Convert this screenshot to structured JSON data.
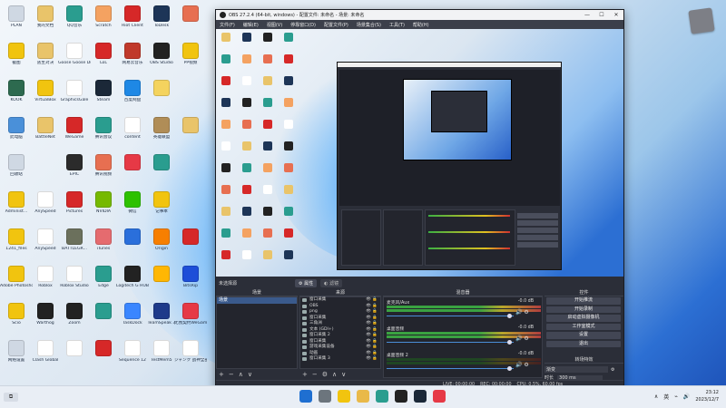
{
  "desktop": {
    "icons": [
      {
        "label": "PLAN",
        "color": "#cfd8e3",
        "col": 0,
        "row": 0
      },
      {
        "label": "我的文档",
        "color": "#e9c46a",
        "col": 1,
        "row": 0
      },
      {
        "label": "QQ音乐",
        "color": "#2a9d8f",
        "col": 2,
        "row": 0
      },
      {
        "label": "Scratch",
        "color": "#f4a261",
        "col": 3,
        "row": 0
      },
      {
        "label": "Riot Client",
        "color": "#d62828",
        "col": 4,
        "row": 0
      },
      {
        "label": "ToDesk",
        "color": "#1d3557",
        "col": 5,
        "row": 0
      },
      {
        "label": "",
        "color": "#e76f51",
        "col": 6,
        "row": 0
      },
      {
        "label": "截图",
        "color": "#f1c40f",
        "col": 0,
        "row": 1
      },
      {
        "label": "逃生对决",
        "color": "#e9c46a",
        "col": 1,
        "row": 1
      },
      {
        "label": "Goose Goose Duck",
        "color": "#ffffff",
        "col": 2,
        "row": 1
      },
      {
        "label": "LoL",
        "color": "#d62828",
        "col": 3,
        "row": 1
      },
      {
        "label": "网易云音乐",
        "color": "#c0392b",
        "col": 4,
        "row": 1
      },
      {
        "label": "OBS Studio",
        "color": "#222222",
        "col": 5,
        "row": 1
      },
      {
        "label": "PP视频",
        "color": "#f1c40f",
        "col": 6,
        "row": 1
      },
      {
        "label": "KOOK",
        "color": "#2d6a4f",
        "col": 0,
        "row": 2
      },
      {
        "label": "VirtualBox",
        "color": "#f1c40f",
        "col": 1,
        "row": 2
      },
      {
        "label": "GraphicsGale",
        "color": "#ffffff",
        "col": 2,
        "row": 2
      },
      {
        "label": "Steam",
        "color": "#1b2838",
        "col": 3,
        "row": 2
      },
      {
        "label": "百度网盘",
        "color": "#1e88e5",
        "col": 4,
        "row": 2
      },
      {
        "label": "",
        "color": "#f4d35e",
        "col": 5,
        "row": 2
      },
      {
        "label": "此电脑",
        "color": "#4a90d9",
        "col": 0,
        "row": 3
      },
      {
        "label": "BattleNet",
        "color": "#e9c46a",
        "col": 1,
        "row": 3
      },
      {
        "label": "WeGame",
        "color": "#d62828",
        "col": 2,
        "row": 3
      },
      {
        "label": "腾讯会议",
        "color": "#2a9d8f",
        "col": 3,
        "row": 3
      },
      {
        "label": "content",
        "color": "#ffffff",
        "col": 4,
        "row": 3
      },
      {
        "label": "英雄联盟",
        "color": "#b08d57",
        "col": 5,
        "row": 3
      },
      {
        "label": "",
        "color": "#e9c46a",
        "col": 6,
        "row": 3
      },
      {
        "label": "回收站",
        "color": "#cfd8e3",
        "col": 0,
        "row": 4
      },
      {
        "label": "EPIC",
        "color": "#2b2b2b",
        "col": 2,
        "row": 4
      },
      {
        "label": "腾讯视频",
        "color": "#e76f51",
        "col": 3,
        "row": 4
      },
      {
        "label": "",
        "color": "#e63946",
        "col": 4,
        "row": 4
      },
      {
        "label": "",
        "color": "#2a9d8f",
        "col": 5,
        "row": 4
      },
      {
        "label": "Administ...",
        "color": "#f1c40f",
        "col": 0,
        "row": 5
      },
      {
        "label": "AnySpeed",
        "color": "#ffffff",
        "col": 1,
        "row": 5
      },
      {
        "label": "Pictures",
        "color": "#d62828",
        "col": 2,
        "row": 5
      },
      {
        "label": "NVIDIA",
        "color": "#76b900",
        "col": 3,
        "row": 5
      },
      {
        "label": "微信",
        "color": "#2dc100",
        "col": 4,
        "row": 5
      },
      {
        "label": "记事本",
        "color": "#f1c40f",
        "col": 5,
        "row": 5
      },
      {
        "label": "1241_files",
        "color": "#f1c40f",
        "col": 0,
        "row": 6
      },
      {
        "label": "AnySpeed",
        "color": "#ffffff",
        "col": 1,
        "row": 6
      },
      {
        "label": "BATTLEGR...",
        "color": "#6b705c",
        "col": 2,
        "row": 6
      },
      {
        "label": "iTunes",
        "color": "#e56b6f",
        "col": 3,
        "row": 6
      },
      {
        "label": "",
        "color": "#2a6fdb",
        "col": 4,
        "row": 6
      },
      {
        "label": "Origin",
        "color": "#f77f00",
        "col": 5,
        "row": 6
      },
      {
        "label": "",
        "color": "#d62828",
        "col": 6,
        "row": 6
      },
      {
        "label": "Adobe Photoshop",
        "color": "#f1c40f",
        "col": 0,
        "row": 7
      },
      {
        "label": "Roblox",
        "color": "#ffffff",
        "col": 1,
        "row": 7
      },
      {
        "label": "Roblox Studio",
        "color": "#ffffff",
        "col": 2,
        "row": 7
      },
      {
        "label": "Edge",
        "color": "#2a9d8f",
        "col": 3,
        "row": 7
      },
      {
        "label": "Logitech G HUB",
        "color": "#222222",
        "col": 4,
        "row": 7
      },
      {
        "label": "",
        "color": "#ffb703",
        "col": 5,
        "row": 7
      },
      {
        "label": "BitsRip",
        "color": "#1d4ed8",
        "col": 6,
        "row": 7
      },
      {
        "label": "Scio",
        "color": "#f1c40f",
        "col": 0,
        "row": 8
      },
      {
        "label": "Warthog",
        "color": "#222222",
        "col": 1,
        "row": 8
      },
      {
        "label": "Zoom",
        "color": "#222222",
        "col": 2,
        "row": 8
      },
      {
        "label": "",
        "color": "#2a9d8f",
        "col": 3,
        "row": 8
      },
      {
        "label": "TaskDock",
        "color": "#3a86ff",
        "col": 4,
        "row": 8
      },
      {
        "label": "TeamSpeak 3",
        "color": "#1e3a8a",
        "col": 5,
        "row": 8
      },
      {
        "label": "无畏契约WeGame版",
        "color": "#e63946",
        "col": 6,
        "row": 8
      },
      {
        "label": "网络设置",
        "color": "#cfd8e3",
        "col": 0,
        "row": 9
      },
      {
        "label": "Clash Global",
        "color": "#ffffff",
        "col": 1,
        "row": 9
      },
      {
        "label": "",
        "color": "#ffffff",
        "col": 2,
        "row": 9
      },
      {
        "label": "",
        "color": "#d62828",
        "col": 3,
        "row": 9
      },
      {
        "label": "Sequence 12",
        "color": "#ffffff",
        "col": 4,
        "row": 9
      },
      {
        "label": "TestMem5",
        "color": "#ffffff",
        "col": 5,
        "row": 9
      },
      {
        "label": "ジャンク 战神全部",
        "color": "#ffffff",
        "col": 6,
        "row": 9
      }
    ]
  },
  "obs": {
    "title": "OBS 27.2.4 (64-bit, windows) - 配置文件: 未命名 - 场景: 未命名",
    "menu": [
      "文件(F)",
      "编辑(E)",
      "视图(V)",
      "停靠窗口(D)",
      "配置文件(P)",
      "场景集合(S)",
      "工具(T)",
      "帮助(H)"
    ],
    "scene_label": "未选择源",
    "props_btn": "属性",
    "filters_btn": "滤镜",
    "panels": {
      "scenes": "场景",
      "sources": "来源",
      "mixer": "混音器",
      "transitions": "转场特效",
      "controls": "控件"
    },
    "scenes_list": [
      "场景"
    ],
    "sources_list": [
      "窗口采集",
      "OBS",
      "png",
      "窗口采集",
      "三角洲",
      "文本 (GDI+)",
      "窗口采集 2",
      "窗口采集",
      "游戏采集设备",
      "动画",
      "窗口采集 3"
    ],
    "mixer": [
      {
        "name": "麦克风/Aux",
        "db": "-0.0 dB",
        "active": true
      },
      {
        "name": "桌面音频",
        "db": "-0.0 dB",
        "active": true
      },
      {
        "name": "桌面音频 2",
        "db": "-0.0 dB",
        "active": false
      }
    ],
    "controls": [
      "开始推流",
      "开始录制",
      "启动虚拟摄像机",
      "工作室模式",
      "设置",
      "退出"
    ],
    "transition": {
      "type": "渐变",
      "duration_label": "时长",
      "duration_value": "300 ms"
    },
    "status": {
      "live": "LIVE: 00:00:00",
      "rec": "REC: 00:00:00",
      "cpu": "CPU: 0.5%, 60.00 fps"
    }
  },
  "taskbar": {
    "show_desktop": "⧉",
    "ime": "英",
    "time": "23:12",
    "date": "2023/12/7",
    "icons": [
      {
        "name": "windows-start-icon",
        "color": "#1f6fd1"
      },
      {
        "name": "search-icon",
        "color": "#6c757d"
      },
      {
        "name": "file-explorer-icon",
        "color": "#f1c40f"
      },
      {
        "name": "folder-icon",
        "color": "#e9b949"
      },
      {
        "name": "edge-icon",
        "color": "#2a9d8f"
      },
      {
        "name": "obs-icon",
        "color": "#222222"
      },
      {
        "name": "steam-icon",
        "color": "#1b2838"
      },
      {
        "name": "game-icon",
        "color": "#e63946"
      }
    ]
  }
}
